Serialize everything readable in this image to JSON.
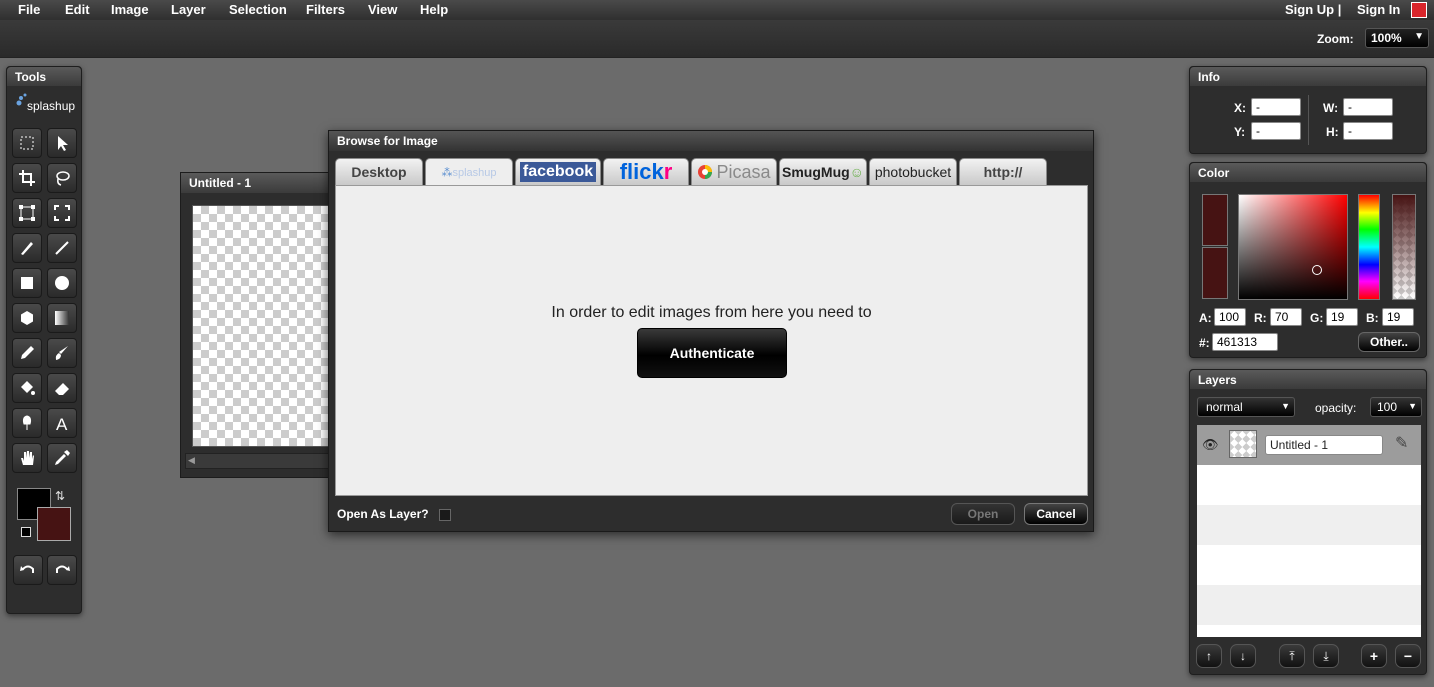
{
  "menu": {
    "items": [
      "File",
      "Edit",
      "Image",
      "Layer",
      "Selection",
      "Filters",
      "View",
      "Help"
    ],
    "sign_up": "Sign Up |",
    "sign_in": "Sign In"
  },
  "toolbar": {
    "zoom_label": "Zoom:",
    "zoom_value": "100%"
  },
  "tools_panel": {
    "title": "Tools",
    "logo": "splashup",
    "tools": [
      "rect-select-icon",
      "pointer-icon",
      "crop-icon",
      "lasso-icon",
      "transform-icon",
      "free-transform-icon",
      "brush-icon",
      "line-icon",
      "rectangle-icon",
      "ellipse-icon",
      "polygon-icon",
      "gradient-icon",
      "pencil-icon",
      "paint-brush-icon",
      "bucket-icon",
      "eraser-icon",
      "smudge-icon",
      "text-icon",
      "hand-icon",
      "eyedropper-icon"
    ],
    "fg_color": "#000000",
    "bg_color": "#461313"
  },
  "document": {
    "title": "Untitled - 1"
  },
  "dialog": {
    "title": "Browse for Image",
    "tabs": [
      "Desktop",
      "splashup",
      "facebook",
      "flickr",
      "Picasa",
      "SmugMug",
      "photobucket",
      "http://"
    ],
    "message": "In order to edit images from here you need to",
    "authenticate_label": "Authenticate",
    "open_as_layer_label": "Open As Layer?",
    "open_label": "Open",
    "cancel_label": "Cancel"
  },
  "info_panel": {
    "title": "Info",
    "x_label": "X:",
    "x_value": "-",
    "y_label": "Y:",
    "y_value": "-",
    "w_label": "W:",
    "w_value": "-",
    "h_label": "H:",
    "h_value": "-"
  },
  "color_panel": {
    "title": "Color",
    "a_label": "A:",
    "a_value": "100",
    "r_label": "R:",
    "r_value": "70",
    "g_label": "G:",
    "g_value": "19",
    "b_label": "B:",
    "b_value": "19",
    "hex_label": "#:",
    "hex_value": "461313",
    "other_label": "Other..",
    "current_color": "#461313"
  },
  "layers_panel": {
    "title": "Layers",
    "blend_mode": "normal",
    "opacity_label": "opacity:",
    "opacity_value": "100",
    "layers": [
      {
        "name": "Untitled - 1"
      }
    ]
  }
}
